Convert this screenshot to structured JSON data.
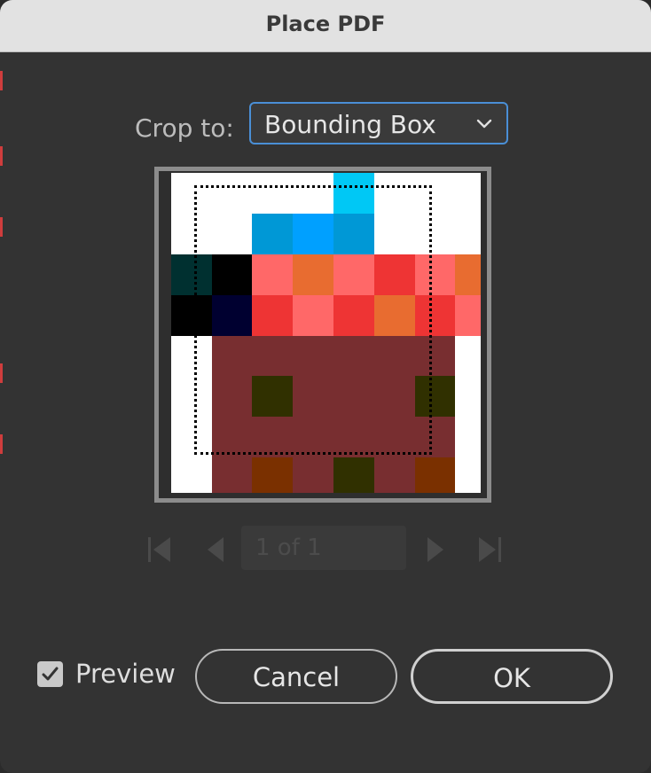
{
  "window": {
    "title": "Place PDF"
  },
  "crop": {
    "label": "Crop to:",
    "selected": "Bounding Box"
  },
  "pager": {
    "page_text": "1 of 1"
  },
  "footer": {
    "preview_label": "Preview",
    "preview_checked": true,
    "cancel_label": "Cancel",
    "ok_label": "OK"
  },
  "colors": {
    "dialog_bg": "#333333",
    "titlebar_bg": "#e2e2e2",
    "accent_focus": "#4a8fd6",
    "preview_pixels": {
      "cyan": "#00c8f5",
      "blue": "#0098d6",
      "bright_blue": "#00a0ff",
      "dark_teal": "#003030",
      "black": "#000000",
      "navy": "#000030",
      "salmon": "#ff6868",
      "orange": "#e86c30",
      "red": "#ee3434",
      "maroon": "#782e30",
      "olive": "#303000",
      "brown": "#7a3000"
    }
  }
}
